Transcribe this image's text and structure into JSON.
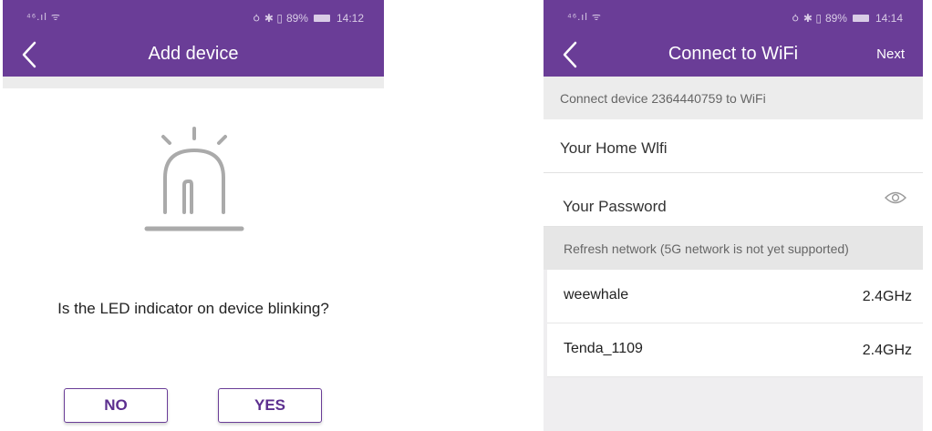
{
  "colors": {
    "accent": "#6a3d97",
    "band": "#ececec",
    "icon": "#aaaaaa"
  },
  "left_screen": {
    "status": {
      "signal": "⁴⁶.ıl ᯤ",
      "icons": "ㆁ ✱ ▯",
      "battery": "89%",
      "time": "14:12"
    },
    "nav": {
      "back_icon": "chevron-left-icon",
      "title": "Add device"
    },
    "illustration": "alarm-light-icon",
    "question": "Is the LED indicator on device blinking?",
    "no_label": "NO",
    "yes_label": "YES"
  },
  "right_screen": {
    "status": {
      "signal": "⁴⁶.ıl ᯤ",
      "icons": "ㆁ ✱ ▯",
      "battery": "89%",
      "time": "14:14"
    },
    "nav": {
      "back_icon": "chevron-left-icon",
      "title": "Connect to WiFi",
      "next_label": "Next"
    },
    "connect_hint": "Connect device 2364440759 to WiFi",
    "wifi_field": "Your Home Wlfi",
    "password_field": "Your Password",
    "password_icon": "eye-icon",
    "refresh_label": "Refresh network (5G network is not yet supported)",
    "networks": [
      {
        "name": "weewhale",
        "band": "2.4GHz"
      },
      {
        "name": "Tenda_1109",
        "band": "2.4GHz"
      }
    ]
  }
}
